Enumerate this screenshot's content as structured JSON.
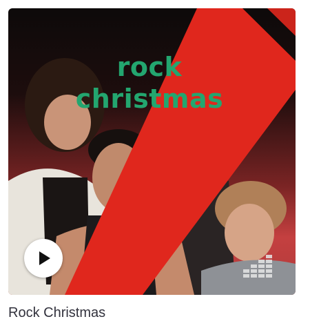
{
  "playlist": {
    "cover_title_line1": "rock",
    "cover_title_line2": "christmas",
    "caption": "Rock Christmas",
    "play_icon": "play-icon",
    "brand_icon": "deezer-logo-icon"
  },
  "colors": {
    "title_green": "#23a66f",
    "ribbon_red": "#e0271d",
    "caption_text": "#32323d"
  }
}
